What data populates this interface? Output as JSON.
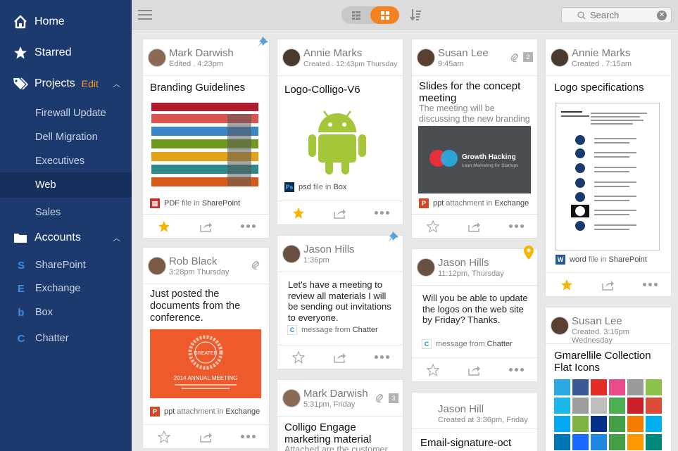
{
  "sidebar": {
    "home": "Home",
    "starred": "Starred",
    "projects": "Projects",
    "projects_edit": "Edit",
    "project_items": [
      "Firewall Update",
      "Dell Migration",
      "Executives",
      "Web",
      "Sales"
    ],
    "accounts": "Accounts",
    "account_items": [
      "SharePoint",
      "Exchange",
      "Box",
      "Chatter"
    ]
  },
  "topbar": {
    "search_placeholder": "Search"
  },
  "cards": {
    "c1": {
      "name": "Mark Darwish",
      "sub": "Edited . 4:23pm",
      "title": "Branding Guidelines",
      "src_type": "PDF",
      "src_mid": "file in",
      "src_app": "SharePoint"
    },
    "c2": {
      "name": "Rob Black",
      "sub": "3:28pm Thursday",
      "body": "Just posted the documents from the conference.",
      "src_type": "ppt",
      "src_mid": "attachment in",
      "src_app": "Exchange",
      "thumb_line1": "GREATER",
      "thumb_line2": "2014 ANNUAL MEETING"
    },
    "c3": {
      "name": "Annie Marks",
      "sub": "Created . 12:43pm Thursday",
      "title": "Logo-Colligo-V6",
      "src_type": "psd",
      "src_mid": "file in",
      "src_app": "Box"
    },
    "c4": {
      "name": "Jason Hills",
      "sub": "1:36pm",
      "body": "Let's have a meeting to review all materials I will be sending out invitations to everyone.",
      "src_type": "message",
      "src_mid": "from",
      "src_app": "Chatter"
    },
    "c5": {
      "name": "Mark Darwish",
      "sub": "5:31pm, Friday",
      "count": "3",
      "title": "Colligo Engage marketing material",
      "desc": "Attached are the customer PPT"
    },
    "c6": {
      "name": "Susan Lee",
      "sub": "9:45am",
      "count": "2",
      "title": "Slides for the concept meeting",
      "desc": "The meeting will be discussing the new branding guides...",
      "src_type": "ppt",
      "src_mid": "attachment in",
      "src_app": "Exchange",
      "thumb_title": "Growth Hacking",
      "thumb_sub": "Lean Marketing for Startups"
    },
    "c7": {
      "name": "Jason Hills",
      "sub": "11:12pm, Thursday",
      "body": "Will you be able to update the logos on the web site by Friday? Thanks.",
      "src_type": "message",
      "src_mid": "from",
      "src_app": "Chatter"
    },
    "c8": {
      "name": "Jason Hill",
      "sub": "Created at 3:36pm, Friday",
      "title": "Email-signature-oct"
    },
    "c9": {
      "name": "Annie Marks",
      "sub": "Created . 7:15am",
      "title": "Logo specifications",
      "src_type": "word",
      "src_mid": "file in",
      "src_app": "SharePoint"
    },
    "c10": {
      "name": "Susan Lee",
      "sub": "Created. 3:16pm Wednesday",
      "title": "Gmarellile Collection Flat Icons"
    }
  },
  "colors": {
    "accent": "#f58220",
    "sidebar": "#1c3a6e",
    "star": "#f5b400"
  }
}
